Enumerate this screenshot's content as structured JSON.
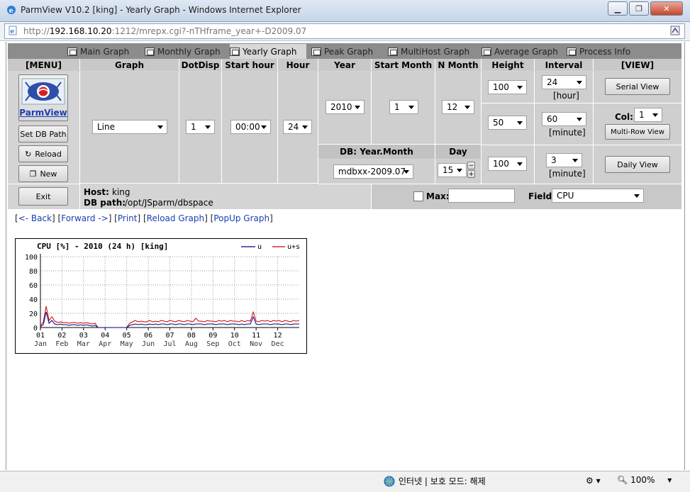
{
  "window": {
    "title": "ParmView V10.2 [king] - Yearly Graph - Windows Internet Explorer",
    "url_prefix": "http://",
    "url_host": "192.168.10.20",
    "url_rest": ":1212/mrepx.cgi?-nTHframe_year+-D2009.07"
  },
  "tabs": [
    {
      "label": "Main Graph",
      "active": false
    },
    {
      "label": "Monthly Graph",
      "active": false
    },
    {
      "label": "Yearly Graph",
      "active": true
    },
    {
      "label": "Peak Graph",
      "active": false
    },
    {
      "label": "MultiHost Graph",
      "active": false
    },
    {
      "label": "Average Graph",
      "active": false
    },
    {
      "label": "Process Info",
      "active": false
    }
  ],
  "headers": {
    "menu": "[MENU]",
    "graph": "Graph",
    "dotdisp": "DotDisp",
    "start_hour": "Start hour",
    "hour": "Hour",
    "year": "Year",
    "start_month": "Start Month",
    "n_month": "N Month",
    "height": "Height",
    "interval": "Interval",
    "view": "[VIEW]",
    "db_year_month": "DB: Year.Month",
    "day": "Day"
  },
  "menu": {
    "logo_label": "ParmView",
    "set_db_path": "Set DB Path",
    "reload": "Reload",
    "new": "New",
    "exit": "Exit"
  },
  "controls": {
    "graph_type": "Line",
    "dotdisp": "1",
    "start_hour": "00:00",
    "hour": "24",
    "year": "2010",
    "start_month": "1",
    "n_month": "12",
    "db_year_month": "mdbxx-2009.07",
    "day": "15",
    "height1": "100",
    "height2": "50",
    "height3": "100",
    "interval1": "24",
    "interval1_unit": "[hour]",
    "interval2": "60",
    "interval2_unit": "[minute]",
    "interval3": "3",
    "interval3_unit": "[minute]",
    "col_label": "Col:",
    "col_value": "1",
    "serial_view": "Serial View",
    "multi_row_view": "Multi-Row View",
    "daily_view": "Daily View",
    "max_label": "Max:",
    "max_value": "",
    "field_label": "Field:",
    "field_value": "CPU"
  },
  "host_info": {
    "host_label": "Host:",
    "host_value": "king",
    "db_path_label": "DB path:",
    "db_path_value": "/opt/JSparm/dbspace"
  },
  "links": {
    "back": "<- Back",
    "forward": "Forward ->",
    "print": "Print",
    "reload_graph": "Reload Graph",
    "popup_graph": "PopUp Graph"
  },
  "chart_data": {
    "type": "line",
    "title": "CPU [%] - 2010 (24 h) [king]",
    "xlabel": "",
    "ylabel": "",
    "ylim": [
      0,
      100
    ],
    "y_ticks": [
      "100",
      "80",
      "60",
      "40",
      "20",
      "0"
    ],
    "x_ticks_num": [
      "01",
      "02",
      "03",
      "04",
      "05",
      "06",
      "07",
      "08",
      "09",
      "10",
      "11",
      "12"
    ],
    "x_ticks_mon": [
      "Jan",
      "Feb",
      "Mar",
      "Apr",
      "May",
      "Jun",
      "Jul",
      "Aug",
      "Sep",
      "Oct",
      "Nov",
      "Dec"
    ],
    "legend_position": "top-right",
    "grid": true,
    "series": [
      {
        "name": "u",
        "color": "#000080",
        "values": [
          1,
          4,
          22,
          6,
          10,
          5,
          4,
          5,
          4,
          4,
          3,
          4,
          4,
          3,
          4,
          3,
          4,
          3,
          2,
          3,
          0,
          0,
          0,
          0,
          0,
          0,
          0,
          0,
          0,
          0,
          0,
          3,
          4,
          5,
          4,
          5,
          4,
          4,
          5,
          4,
          5,
          4,
          5,
          5,
          4,
          5,
          5,
          4,
          5,
          5,
          4,
          5,
          5,
          4,
          5,
          5,
          5,
          4,
          5,
          5,
          5,
          4,
          5,
          5,
          5,
          4,
          5,
          5,
          5,
          4,
          5,
          4,
          5,
          5,
          15,
          5,
          4,
          5,
          5,
          5,
          4,
          5,
          5,
          5,
          4,
          5,
          5,
          4,
          5,
          5,
          5
        ]
      },
      {
        "name": "u+s",
        "color": "#cc0000",
        "values": [
          2,
          8,
          30,
          10,
          15,
          9,
          7,
          8,
          7,
          7,
          6,
          7,
          7,
          6,
          7,
          6,
          7,
          6,
          5,
          6,
          0,
          0,
          0,
          0,
          0,
          0,
          0,
          0,
          0,
          0,
          0,
          6,
          8,
          10,
          8,
          9,
          8,
          8,
          10,
          8,
          9,
          8,
          10,
          9,
          8,
          10,
          9,
          8,
          10,
          9,
          8,
          10,
          9,
          8,
          13,
          9,
          9,
          8,
          10,
          9,
          9,
          8,
          10,
          9,
          10,
          8,
          10,
          9,
          9,
          8,
          10,
          8,
          10,
          9,
          22,
          9,
          8,
          10,
          9,
          10,
          8,
          10,
          9,
          10,
          8,
          10,
          9,
          8,
          10,
          9,
          10
        ]
      }
    ]
  },
  "statusbar": {
    "zone": "인터넷 | 보호 모드: 해제",
    "zoom": "100%"
  }
}
